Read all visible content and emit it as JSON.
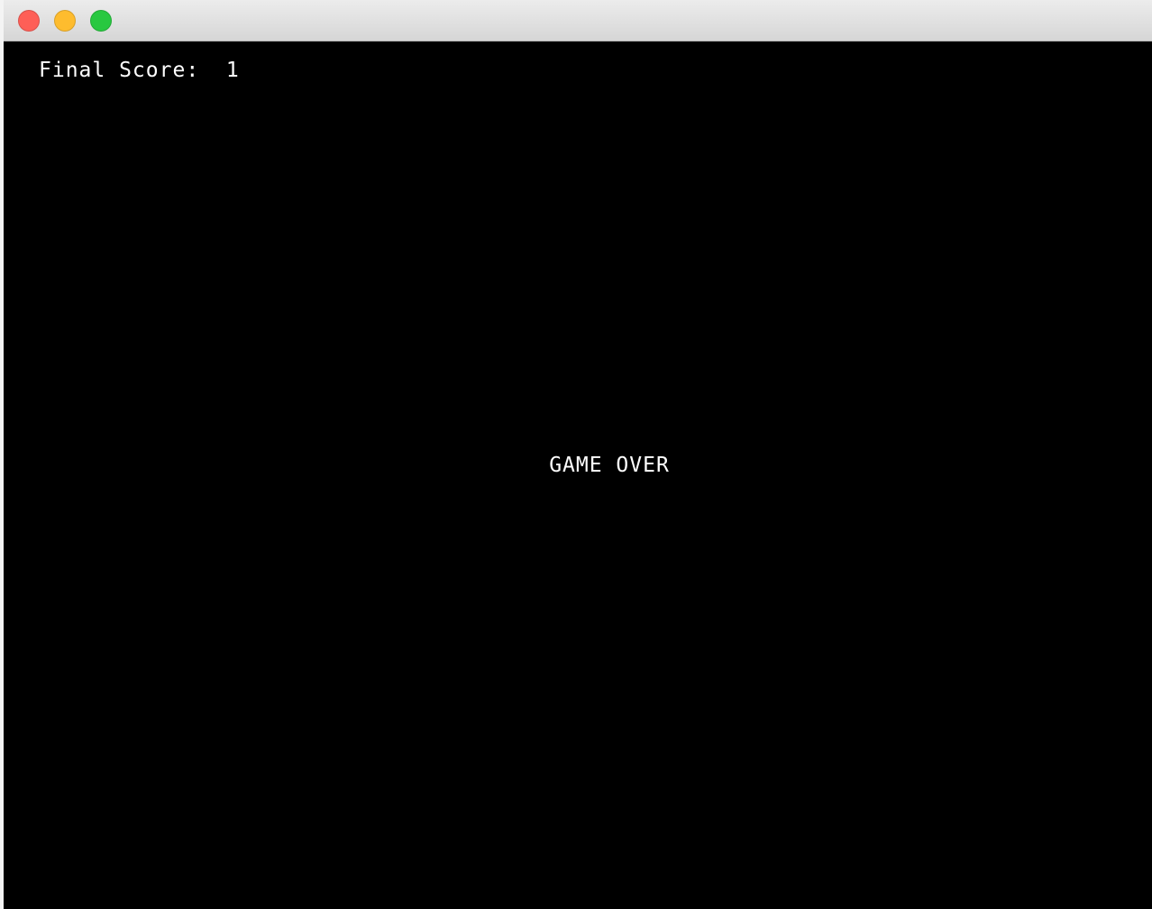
{
  "window": {
    "controls": {
      "close_color": "#fe5f57",
      "minimize_color": "#febc2e",
      "zoom_color": "#28c840"
    }
  },
  "game": {
    "score_label": "Final Score:",
    "score_value": "1",
    "message": "GAME OVER",
    "background_color": "#000000",
    "text_color": "#ffffff"
  }
}
